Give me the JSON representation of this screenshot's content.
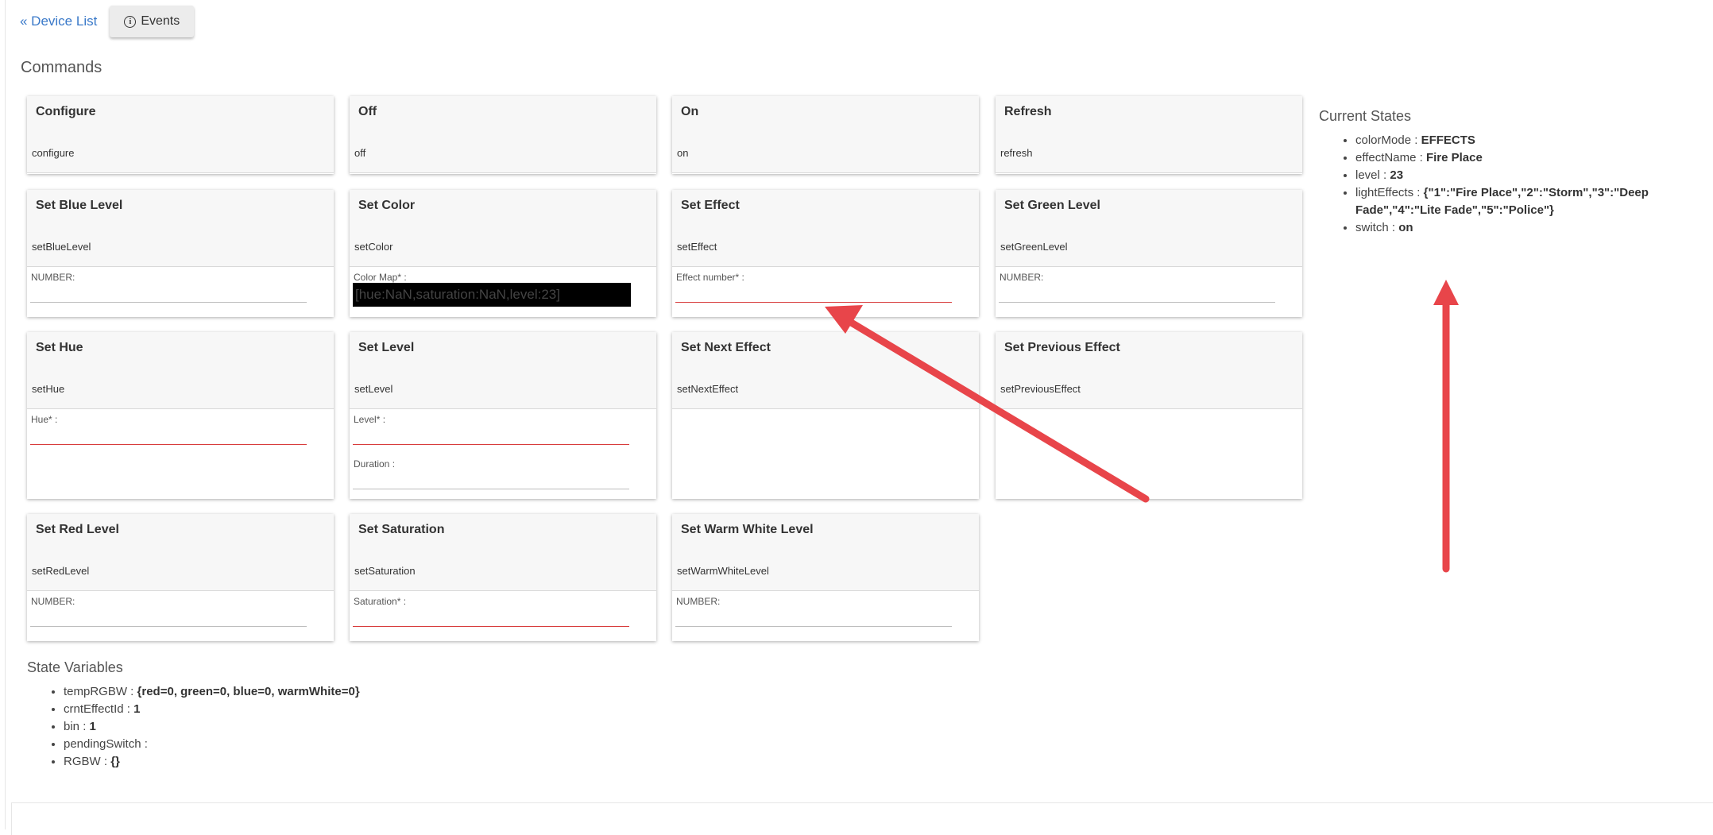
{
  "nav": {
    "back_label": "« Device List",
    "events_label": "Events"
  },
  "commands": {
    "title": "Commands",
    "cards": [
      {
        "title": "Configure",
        "command": "configure",
        "fields": []
      },
      {
        "title": "Off",
        "command": "off",
        "fields": []
      },
      {
        "title": "On",
        "command": "on",
        "fields": []
      },
      {
        "title": "Refresh",
        "command": "refresh",
        "fields": []
      },
      {
        "title": "Set Blue Level",
        "command": "setBlueLevel",
        "fields": [
          {
            "label": "NUMBER:",
            "required": false
          }
        ]
      },
      {
        "title": "Set Color",
        "command": "setColor",
        "fields": [
          {
            "label": "Color Map* :",
            "required": true,
            "value": "[hue:NaN,saturation:NaN,level:23]"
          }
        ]
      },
      {
        "title": "Set Effect",
        "command": "setEffect",
        "fields": [
          {
            "label": "Effect number* :",
            "required": true
          }
        ]
      },
      {
        "title": "Set Green Level",
        "command": "setGreenLevel",
        "fields": [
          {
            "label": "NUMBER:",
            "required": false
          }
        ]
      },
      {
        "title": "Set Hue",
        "command": "setHue",
        "fields": [
          {
            "label": "Hue* :",
            "required": true
          }
        ]
      },
      {
        "title": "Set Level",
        "command": "setLevel",
        "fields": [
          {
            "label": "Level* :",
            "required": true
          },
          {
            "label": "Duration :",
            "required": false
          }
        ]
      },
      {
        "title": "Set Next Effect",
        "command": "setNextEffect",
        "fields": []
      },
      {
        "title": "Set Previous Effect",
        "command": "setPreviousEffect",
        "fields": []
      },
      {
        "title": "Set Red Level",
        "command": "setRedLevel",
        "fields": [
          {
            "label": "NUMBER:",
            "required": false
          }
        ]
      },
      {
        "title": "Set Saturation",
        "command": "setSaturation",
        "fields": [
          {
            "label": "Saturation* :",
            "required": true
          }
        ]
      },
      {
        "title": "Set Warm White Level",
        "command": "setWarmWhiteLevel",
        "fields": [
          {
            "label": "NUMBER:",
            "required": false
          }
        ]
      }
    ]
  },
  "current_states": {
    "title": "Current States",
    "items": [
      {
        "key": "colorMode",
        "value": "EFFECTS"
      },
      {
        "key": "effectName",
        "value": "Fire Place"
      },
      {
        "key": "level",
        "value": "23"
      },
      {
        "key": "lightEffects",
        "value": "{\"1\":\"Fire Place\",\"2\":\"Storm\",\"3\":\"Deep Fade\",\"4\":\"Lite Fade\",\"5\":\"Police\"}"
      },
      {
        "key": "switch",
        "value": "on"
      }
    ]
  },
  "state_variables": {
    "title": "State Variables",
    "items": [
      {
        "key": "tempRGBW",
        "value": "{red=0, green=0, blue=0, warmWhite=0}"
      },
      {
        "key": "crntEffectId",
        "value": "1"
      },
      {
        "key": "bin",
        "value": "1"
      },
      {
        "key": "pendingSwitch",
        "value": ""
      },
      {
        "key": "RGBW",
        "value": "{}"
      }
    ]
  },
  "colors": {
    "accent_link": "#3a79c9",
    "required_line": "#d83c3c",
    "annotation_arrow": "#e8454a"
  }
}
